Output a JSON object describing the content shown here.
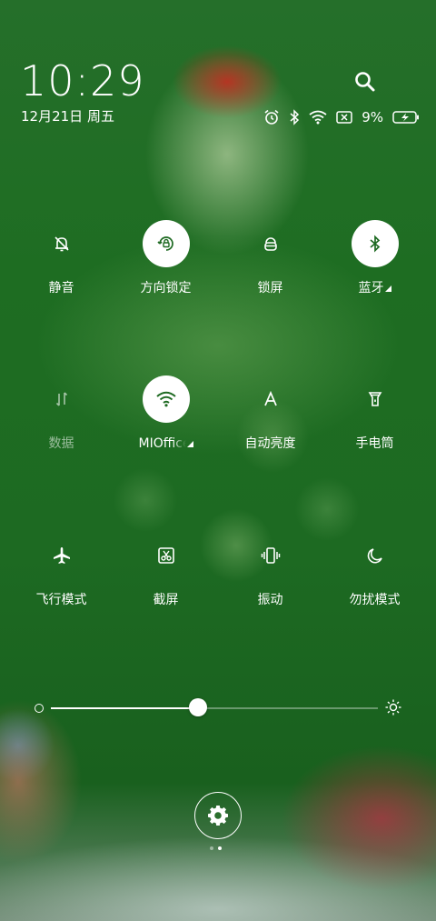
{
  "status": {
    "time": "10:29",
    "date": "12月21日 周五",
    "battery_percent": "9%"
  },
  "icons": {
    "search": "search-icon",
    "alarm": "alarm-icon",
    "bluetooth": "bluetooth-icon",
    "wifi": "wifi-icon",
    "sim": "no-sim-icon",
    "battery": "battery-charging-icon",
    "settings": "gear-icon"
  },
  "tiles": [
    {
      "label": "静音",
      "icon": "bell-off-icon",
      "active": false
    },
    {
      "label": "方向锁定",
      "icon": "rotation-lock-icon",
      "active": true
    },
    {
      "label": "锁屏",
      "icon": "lock-icon",
      "active": false
    },
    {
      "label": "蓝牙",
      "icon": "bluetooth-icon",
      "active": true
    },
    {
      "label": "数据",
      "icon": "mobile-data-icon",
      "active": false
    },
    {
      "label": "MIOffice",
      "icon": "wifi-icon",
      "active": true
    },
    {
      "label": "自动亮度",
      "icon": "auto-brightness-icon",
      "active": false
    },
    {
      "label": "手电筒",
      "icon": "flashlight-icon",
      "active": false
    },
    {
      "label": "飞行模式",
      "icon": "airplane-icon",
      "active": false
    },
    {
      "label": "截屏",
      "icon": "screenshot-icon",
      "active": false
    },
    {
      "label": "振动",
      "icon": "vibrate-icon",
      "active": false
    },
    {
      "label": "勿扰模式",
      "icon": "moon-icon",
      "active": false
    }
  ],
  "brightness": {
    "level": 0.45
  },
  "pager": {
    "pages": 2,
    "current": 2
  },
  "colors": {
    "active_circle": "#ffffff",
    "active_icon": "#1e6a22",
    "background": "#1f6a22"
  }
}
